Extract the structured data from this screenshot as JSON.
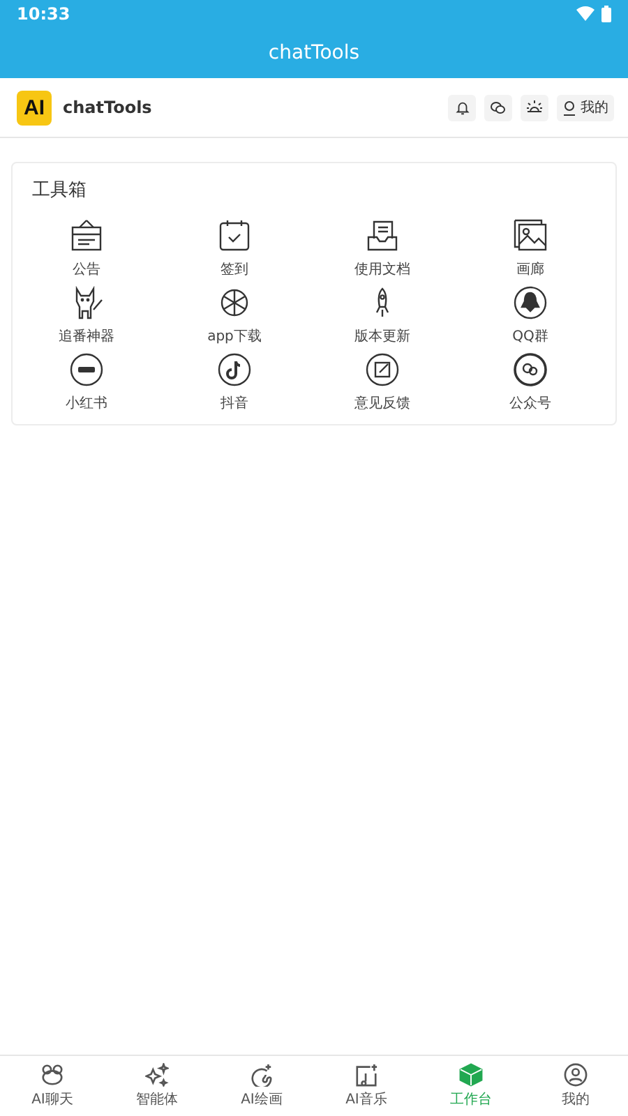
{
  "status_bar": {
    "time": "10:33"
  },
  "app_bar": {
    "title": "chatTools"
  },
  "header": {
    "logo": "AI",
    "name": "chatTools",
    "profile_button": "我的"
  },
  "toolbox": {
    "title": "工具箱",
    "items": [
      {
        "label": "公告"
      },
      {
        "label": "签到"
      },
      {
        "label": "使用文档"
      },
      {
        "label": "画廊"
      },
      {
        "label": "追番神器"
      },
      {
        "label": "app下载"
      },
      {
        "label": "版本更新"
      },
      {
        "label": "QQ群"
      },
      {
        "label": "小红书"
      },
      {
        "label": "抖音"
      },
      {
        "label": "意见反馈"
      },
      {
        "label": "公众号"
      }
    ]
  },
  "bottom_nav": [
    {
      "label": "AI聊天",
      "selected": false
    },
    {
      "label": "智能体",
      "selected": false
    },
    {
      "label": "AI绘画",
      "selected": false
    },
    {
      "label": "AI音乐",
      "selected": false
    },
    {
      "label": "工作台",
      "selected": true
    },
    {
      "label": "我的",
      "selected": false
    }
  ]
}
